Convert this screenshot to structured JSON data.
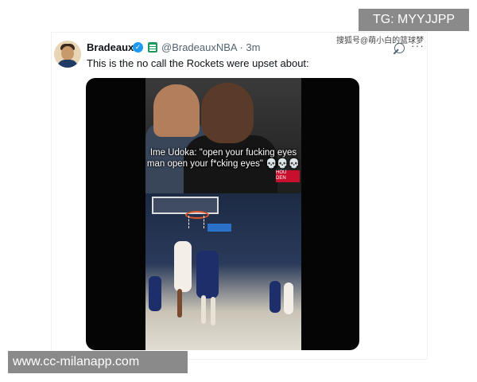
{
  "overlays": {
    "tg_label": "TG: MYYJJPP",
    "site_label": "www.cc-milanapp.com",
    "cn_watermark": "搜狐号@萌小白的篮球梦"
  },
  "tweet": {
    "author_name": "Bradeaux",
    "handle_time": "@BradeauxNBA · 3m",
    "text": "This is the no call the Rockets were upset about:",
    "more_glyph": "···",
    "verified_glyph": "✓"
  },
  "video": {
    "caption": "Ime Udoka: \"open your fucking eyes man open your f*cking eyes\" 💀💀💀",
    "scorebug_line1": "HOU",
    "scorebug_line2": "DEN"
  },
  "colors": {
    "verified": "#1d9bf0",
    "list_badge": "#1d9b5e",
    "text_primary": "#0f1419",
    "text_secondary": "#536471",
    "overlay_grey": "#8a8a8a"
  },
  "icons": [
    "verified-badge-icon",
    "list-icon",
    "grok-icon",
    "more-icon"
  ]
}
